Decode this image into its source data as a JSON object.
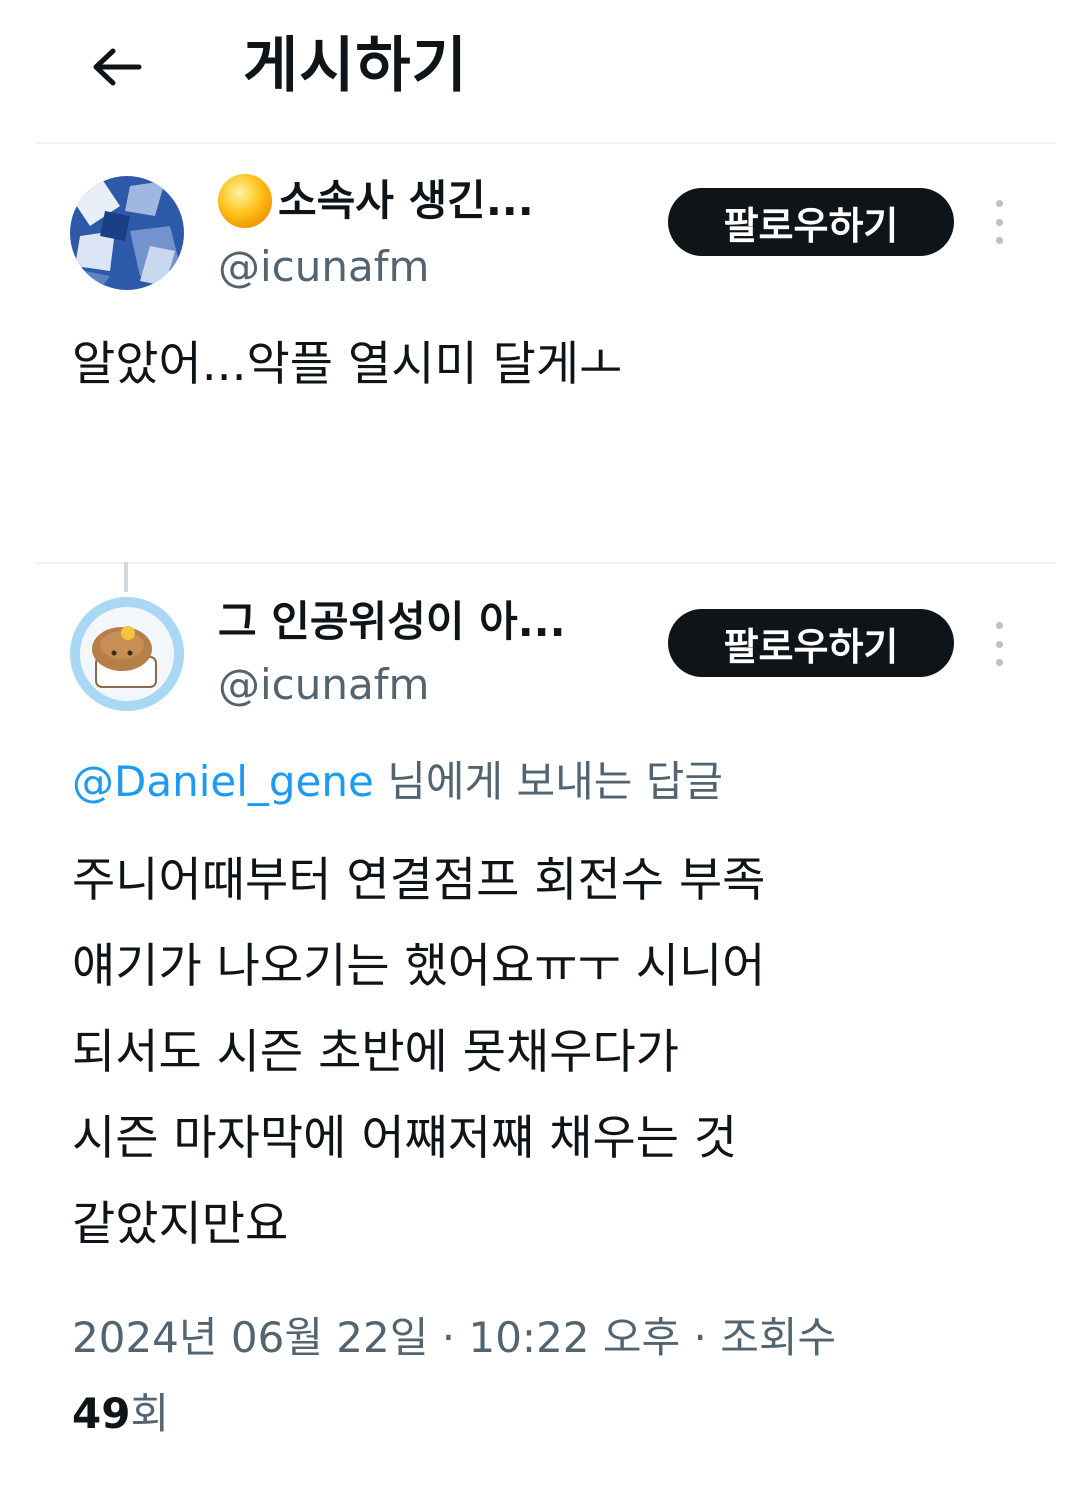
{
  "header": {
    "title": "게시하기",
    "back_icon": "arrow-left-icon"
  },
  "posts": [
    {
      "display_name": "소속사 생긴...",
      "handle": "@icunafm",
      "follow_label": "팔로우하기",
      "text": "알았어...악플 열시미 달게ㅗ"
    },
    {
      "display_name": "그 인공위성이 아...",
      "handle": "@icunafm",
      "follow_label": "팔로우하기",
      "reply_mention": "@Daniel_gene",
      "reply_suffix": "님에게 보내는 답글",
      "text_lines": [
        "주니어때부터  연결점프 회전수 부족",
        "얘기가 나오기는 했어요ㅠㅜ 시니어",
        "되서도 시즌 초반에  못채우다가",
        "시즌 마자막에 어쨰저쨰 채우는 것",
        "같았지만요"
      ],
      "date": "2024년 06월 22일",
      "time": "10:22 오후",
      "views_label": "조회수",
      "views_count": "49",
      "views_suffix": "회"
    }
  ],
  "colors": {
    "text": "#0f1419",
    "secondary": "#536471",
    "link": "#1d9bf0",
    "button": "#0f1419"
  }
}
